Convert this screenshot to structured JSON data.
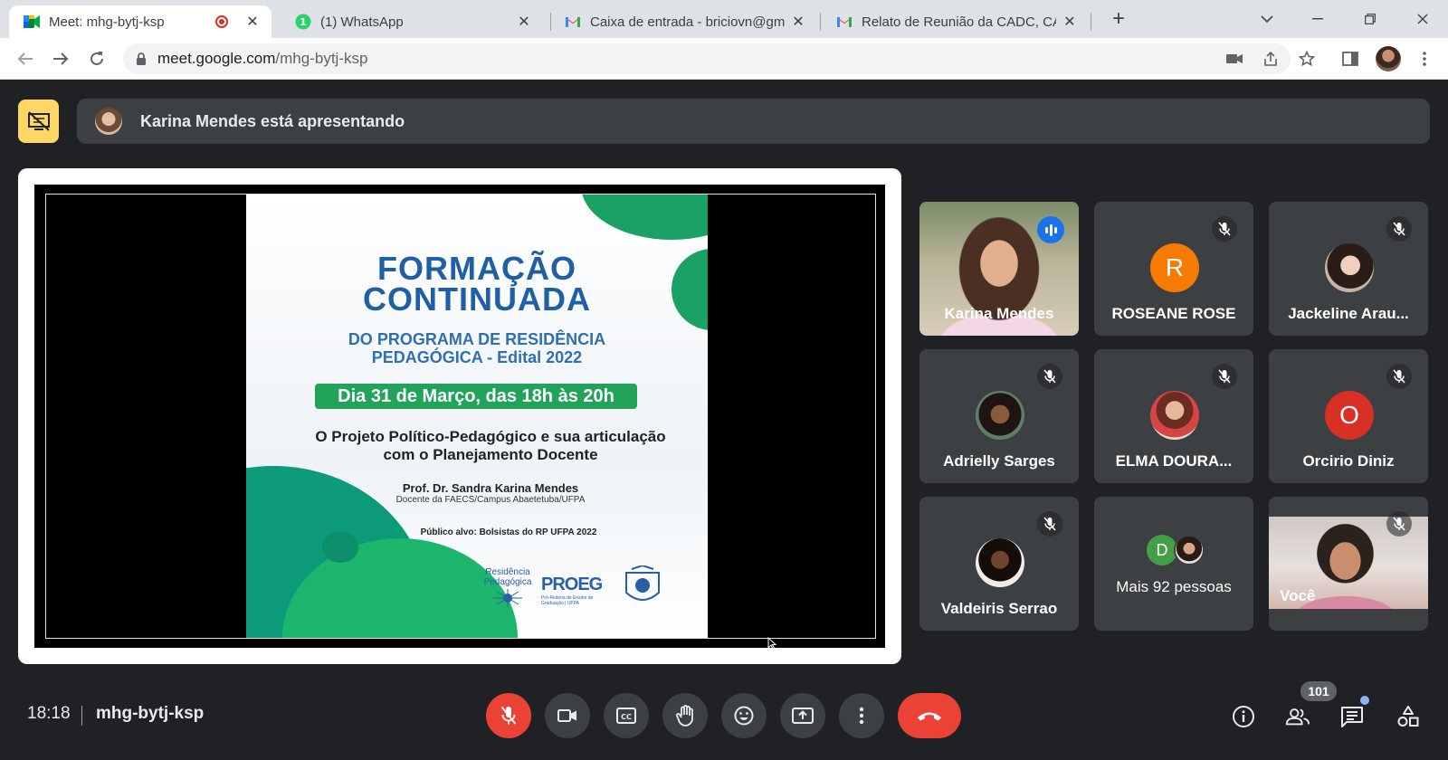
{
  "browser": {
    "tabs": [
      {
        "title": "Meet: mhg-bytj-ksp",
        "favicon": "meet-icon",
        "active": true,
        "recording": true
      },
      {
        "title": "(1) WhatsApp",
        "favicon": "whatsapp-icon",
        "badge": "1"
      },
      {
        "title": "Caixa de entrada - briciovn@gma",
        "favicon": "gmail-icon"
      },
      {
        "title": "Relato de Reunião da CADC, CAC",
        "favicon": "gmail-icon"
      }
    ],
    "address": {
      "host": "meet.google.com",
      "path": "/mhg-bytj-ksp"
    }
  },
  "meet": {
    "presenter_banner": "Karina Mendes está apresentando",
    "slide": {
      "title_line1": "FORMAÇÃO",
      "title_line2": "CONTINUADA",
      "subtitle_line1": "DO PROGRAMA DE RESIDÊNCIA",
      "subtitle_line2": "PEDAGÓGICA - Edital 2022",
      "date_banner": "Dia 31 de Março, das 18h às 20h",
      "topic": "O Projeto Político-Pedagógico e sua articulação com o Planejamento Docente",
      "speaker": "Prof. Dr. Sandra Karina Mendes",
      "speaker_role": "Docente da FAECS/Campus Abaetetuba/UFPA",
      "audience": "Público alvo: Bolsistas do RP UFPA 2022",
      "logo_residencia": "Residência Pedagógica",
      "logo_proeg": "PROEG",
      "logo_proeg_sub": "Pró-Reitoria de Ensino de Graduação | UFPA"
    },
    "participants": [
      {
        "name": "Karina Mendes",
        "type": "video",
        "speaking": true
      },
      {
        "name": "ROSEANE ROSE",
        "type": "letter",
        "letter": "R",
        "color": "#f57c00",
        "muted": true
      },
      {
        "name": "Jackeline Arau...",
        "type": "photo",
        "muted": true
      },
      {
        "name": "Adrielly Sarges",
        "type": "photo",
        "muted": true
      },
      {
        "name": "ELMA DOURA...",
        "type": "photo",
        "muted": true
      },
      {
        "name": "Orcirio Diniz",
        "type": "letter",
        "letter": "O",
        "color": "#d93025",
        "muted": true
      },
      {
        "name": "Valdeiris Serrao",
        "type": "photo",
        "muted": true
      },
      {
        "name": "Mais 92 pessoas",
        "type": "more",
        "letter": "D",
        "letter_color": "#43a047"
      },
      {
        "name": "Você",
        "type": "video",
        "muted": true
      }
    ],
    "footer": {
      "time": "18:18",
      "meeting_code": "mhg-bytj-ksp",
      "people_count": "101"
    },
    "colors": {
      "accent_red": "#ea4335",
      "bg": "#202124",
      "tile": "#3c4043",
      "speaking_blue": "#1a73e8",
      "presenter_yellow": "#fdd663"
    }
  }
}
